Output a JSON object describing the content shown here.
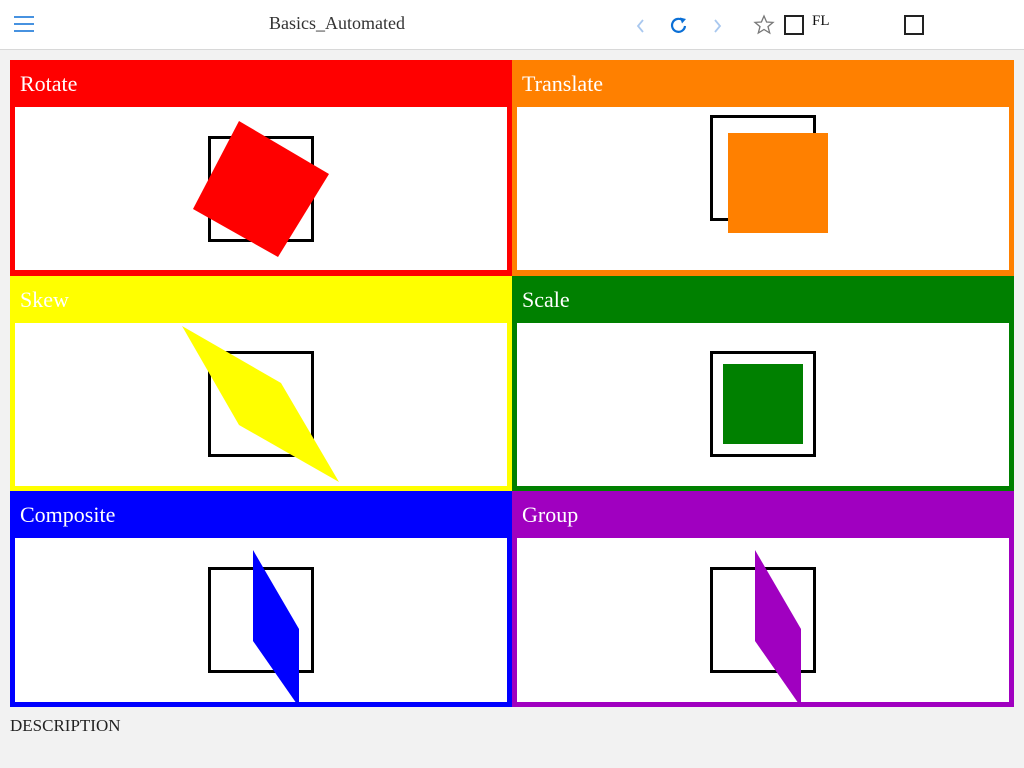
{
  "header": {
    "title": "Basics_Automated",
    "menu_icon": "hamburger-icon",
    "back_icon": "chevron-left-icon",
    "reload_icon": "reload-icon",
    "forward_icon": "chevron-right-icon",
    "star_icon": "star-icon",
    "checkbox_label": "FL",
    "accent": "#0a6fd6"
  },
  "panels": [
    {
      "label": "Rotate",
      "color": "#ff0000"
    },
    {
      "label": "Translate",
      "color": "#ff8000"
    },
    {
      "label": "Skew",
      "color": "#ffff00"
    },
    {
      "label": "Scale",
      "color": "#008000"
    },
    {
      "label": "Composite",
      "color": "#0000ff"
    },
    {
      "label": "Group",
      "color": "#a000c0"
    }
  ],
  "footer": {
    "description": "DESCRIPTION"
  }
}
